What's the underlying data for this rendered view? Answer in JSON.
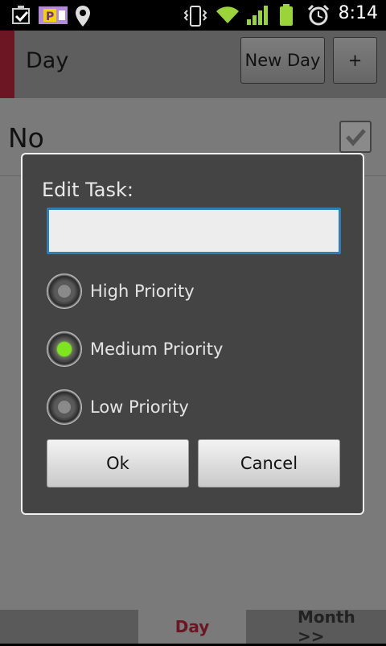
{
  "status_bar": {
    "time": "8:14",
    "icons": [
      "checkbox-notification-icon",
      "ticket-icon",
      "location-icon",
      "vibrate-icon",
      "wifi-icon",
      "signal-icon",
      "battery-icon",
      "alarm-icon"
    ]
  },
  "header": {
    "title": "Day",
    "new_day_label": "New Day",
    "add_label": "+"
  },
  "task_row": {
    "text": "No",
    "checked": true
  },
  "dialog": {
    "title": "Edit Task:",
    "input_value": "",
    "options": [
      {
        "label": "High Priority",
        "selected": false
      },
      {
        "label": "Medium Priority",
        "selected": true
      },
      {
        "label": "Low Priority",
        "selected": false
      }
    ],
    "ok_label": "Ok",
    "cancel_label": "Cancel"
  },
  "bottom_nav": {
    "active_tab": "Day",
    "next_tab": "Month >>"
  },
  "colors": {
    "accent": "#6b1622",
    "selected_radio": "#7fe51f",
    "input_border": "#2e7fb6"
  }
}
